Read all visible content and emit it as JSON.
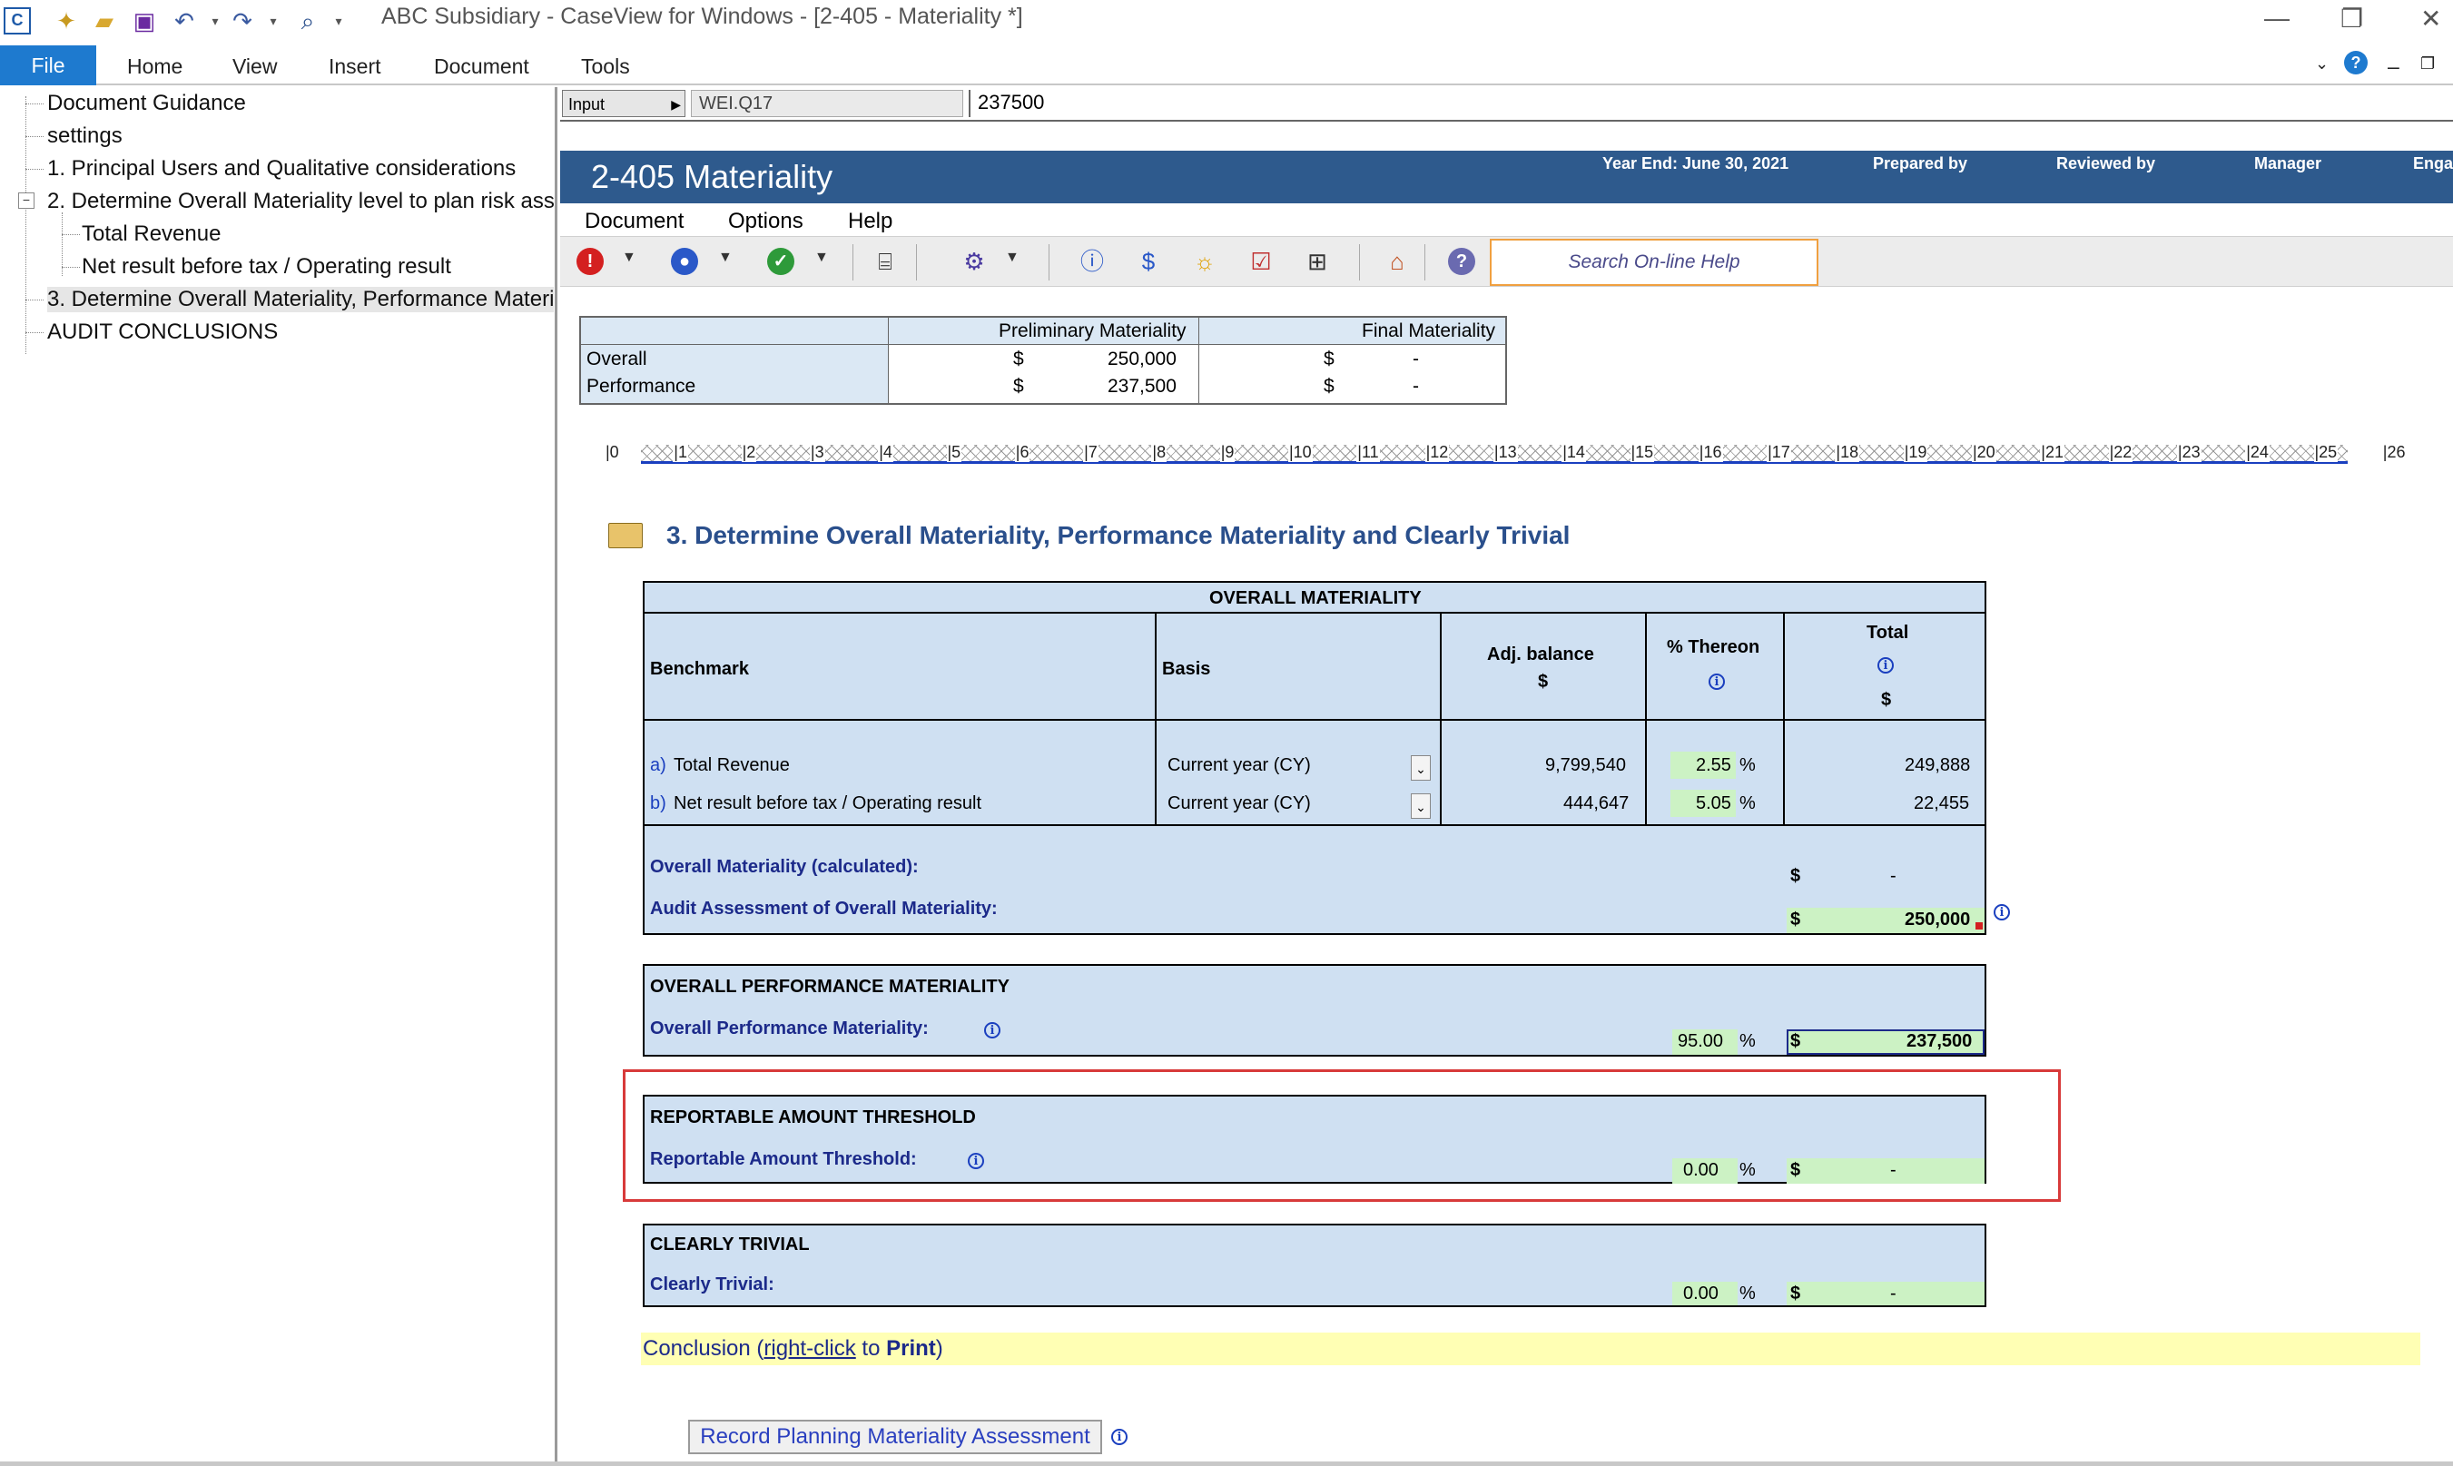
{
  "window": {
    "title": "ABC Subsidiary - CaseView for Windows - [2-405 - Materiality *]",
    "minimize": "—",
    "restore": "❐",
    "close": "✕"
  },
  "ribbon": {
    "file": "File",
    "tabs": [
      "Home",
      "View",
      "Insert",
      "Document",
      "Tools"
    ]
  },
  "tree": {
    "items": [
      "Document Guidance",
      "settings",
      "1. Principal Users and Qualitative considerations",
      "2. Determine Overall Materiality level to plan risk asse",
      "Total Revenue",
      "Net result before tax / Operating result",
      "3. Determine Overall Materiality, Performance Materi",
      "AUDIT CONCLUSIONS"
    ]
  },
  "formula_bar": {
    "cell_type": "Input",
    "cell_ref": "WEI.Q17",
    "value": "237500"
  },
  "doc_header": {
    "title": "2-405 Materiality",
    "year_end": "Year End: June 30, 2021",
    "prepared_by": "Prepared by",
    "reviewed_by": "Reviewed by",
    "manager": "Manager",
    "engagement": "Enga"
  },
  "doc_menu": [
    "Document",
    "Options",
    "Help"
  ],
  "toolbar": {
    "search_help": "Search On-line Help",
    "colors": {
      "red": "#d42020",
      "blue": "#2a58c8",
      "green": "#2e9a3a"
    }
  },
  "summary_table": {
    "headers": [
      "Preliminary Materiality",
      "Final Materiality"
    ],
    "rows": [
      {
        "label": "Overall",
        "currency": "$",
        "prelim": "250,000",
        "final_currency": "$",
        "final": "-"
      },
      {
        "label": "Performance",
        "currency": "$",
        "prelim": "237,500",
        "final_currency": "$",
        "final": "-"
      }
    ]
  },
  "ruler": {
    "labels": [
      "0",
      "1",
      "2",
      "3",
      "4",
      "5",
      "6",
      "7",
      "8",
      "9",
      "10",
      "11",
      "12",
      "13",
      "14",
      "15",
      "16",
      "17",
      "18",
      "19",
      "20",
      "21",
      "22",
      "23",
      "24",
      "25",
      "26"
    ]
  },
  "section": {
    "title": "3. Determine Overall Materiality, Performance Materiality and Clearly Trivial"
  },
  "overall_materiality": {
    "title": "OVERALL MATERIALITY",
    "col_benchmark": "Benchmark",
    "col_basis": "Basis",
    "col_adj": "Adj. balance",
    "col_adj_unit": "$",
    "col_pct": "% Thereon",
    "col_total": "Total",
    "col_total_unit": "$",
    "rows": [
      {
        "letter": "a)",
        "benchmark": "Total Revenue",
        "basis": "Current year (CY)",
        "adj_balance": "9,799,540",
        "pct": "2.55",
        "pct_sign": "%",
        "total": "249,888"
      },
      {
        "letter": "b)",
        "benchmark": "Net result before tax / Operating result",
        "basis": "Current year (CY)",
        "adj_balance": "444,647",
        "pct": "5.05",
        "pct_sign": "%",
        "total": "22,455"
      }
    ],
    "calculated_label": "Overall Materiality (calculated):",
    "calculated_currency": "$",
    "calculated_value": "-",
    "assessment_label": "Audit Assessment of Overall Materiality:",
    "assessment_currency": "$",
    "assessment_value": "250,000"
  },
  "performance_materiality": {
    "title": "OVERALL PERFORMANCE MATERIALITY",
    "label": "Overall Performance Materiality:",
    "pct": "95.00",
    "pct_sign": "%",
    "currency": "$",
    "value": "237,500"
  },
  "reportable_threshold": {
    "title": "REPORTABLE AMOUNT THRESHOLD",
    "label": "Reportable Amount Threshold:",
    "pct": "0.00",
    "pct_sign": "%",
    "currency": "$",
    "value": "-"
  },
  "clearly_trivial": {
    "title": "CLEARLY TRIVIAL",
    "label": "Clearly Trivial:",
    "pct": "0.00",
    "pct_sign": "%",
    "currency": "$",
    "value": "-"
  },
  "conclusion": {
    "prefix": "Conclusion (",
    "link": "right-click",
    "middle": " to ",
    "print": "Print",
    "suffix": ")"
  },
  "record_button": "Record Planning Materiality Assessment",
  "info_glyph": "i"
}
